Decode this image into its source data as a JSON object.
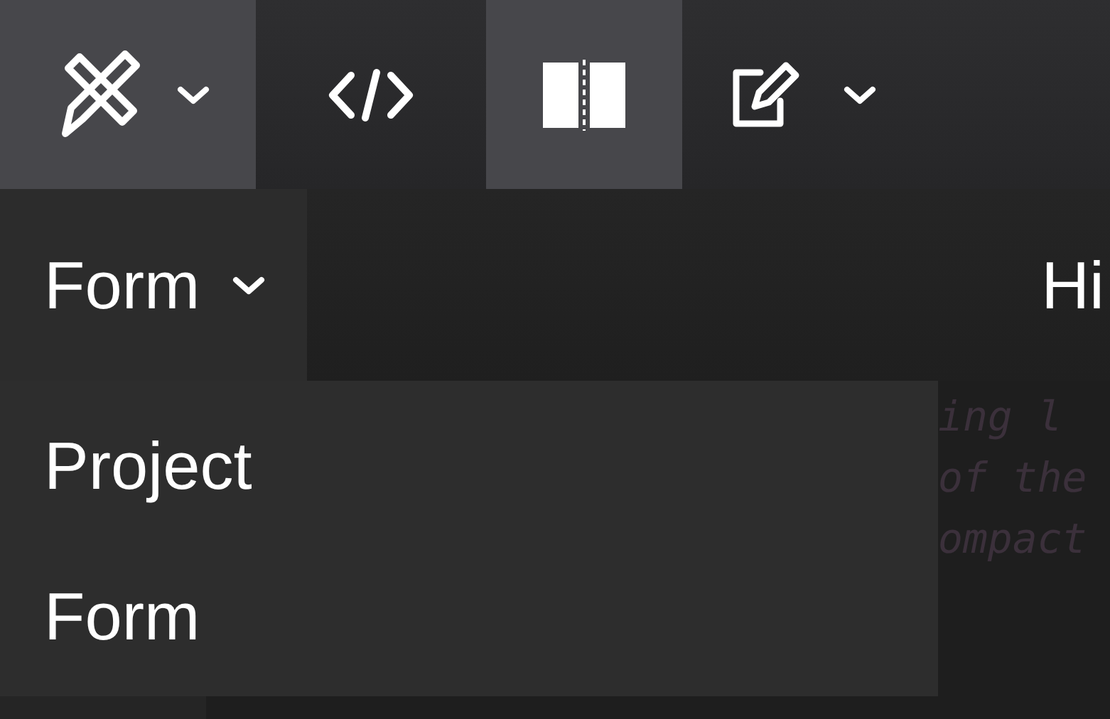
{
  "toolbar": {
    "buttons": [
      {
        "kind": "design",
        "selected": true,
        "has_menu": true
      },
      {
        "kind": "code",
        "selected": false,
        "has_menu": false
      },
      {
        "kind": "split",
        "selected": true,
        "has_menu": false
      },
      {
        "kind": "edit",
        "selected": false,
        "has_menu": true
      }
    ]
  },
  "view_menu": {
    "label": "Form",
    "expanded": true,
    "items": [
      {
        "label": "Project"
      },
      {
        "label": "Form"
      }
    ]
  },
  "header": {
    "title": "Hi"
  },
  "editor": {
    "lines": [
      "ing l",
      "of the",
      "ompact"
    ]
  }
}
